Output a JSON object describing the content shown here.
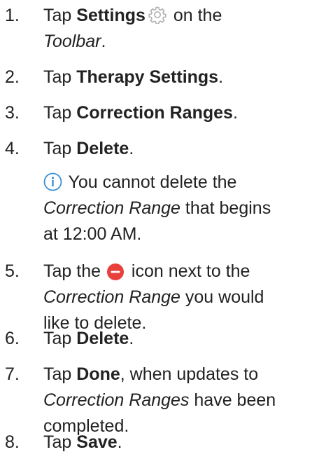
{
  "steps": [
    {
      "number": "1.",
      "pre": "Tap ",
      "bold": "Settings",
      "icon": "gear-icon",
      "post": " on the",
      "line2_italic": "Toolbar",
      "line2_post": "."
    },
    {
      "number": "2.",
      "pre": "Tap ",
      "bold": "Therapy Settings",
      "post": "."
    },
    {
      "number": "3.",
      "pre": "Tap ",
      "bold": "Correction Ranges",
      "post": "."
    },
    {
      "number": "4.",
      "pre": "Tap ",
      "bold": "Delete",
      "post": "."
    },
    {
      "number": "5.",
      "pre": "Tap the ",
      "icon": "minus-circle-icon",
      "post": " icon next to the",
      "line2_italic": "Correction Range",
      "line2_post": " you would",
      "line3": "like to delete."
    },
    {
      "number": "6.",
      "pre": "Tap ",
      "bold": "Delete",
      "post": "."
    },
    {
      "number": "7.",
      "pre": "Tap ",
      "bold": "Done",
      "post": ", when updates to",
      "line2_italic": "Correction Ranges",
      "line2_post": " have been",
      "line3": "completed."
    },
    {
      "number": "8.",
      "pre": "Tap ",
      "bold": "Save",
      "post": "."
    }
  ],
  "note": {
    "icon": "info-icon",
    "line1": " You cannot delete the",
    "line2_italic": "Correction Range",
    "line2_post": " that begins",
    "line3": "at 12:00 AM."
  },
  "colors": {
    "text": "#222222",
    "gear_icon": "#b0b0b0",
    "info_icon": "#3a8fd6",
    "minus_icon": "#e8413c"
  }
}
